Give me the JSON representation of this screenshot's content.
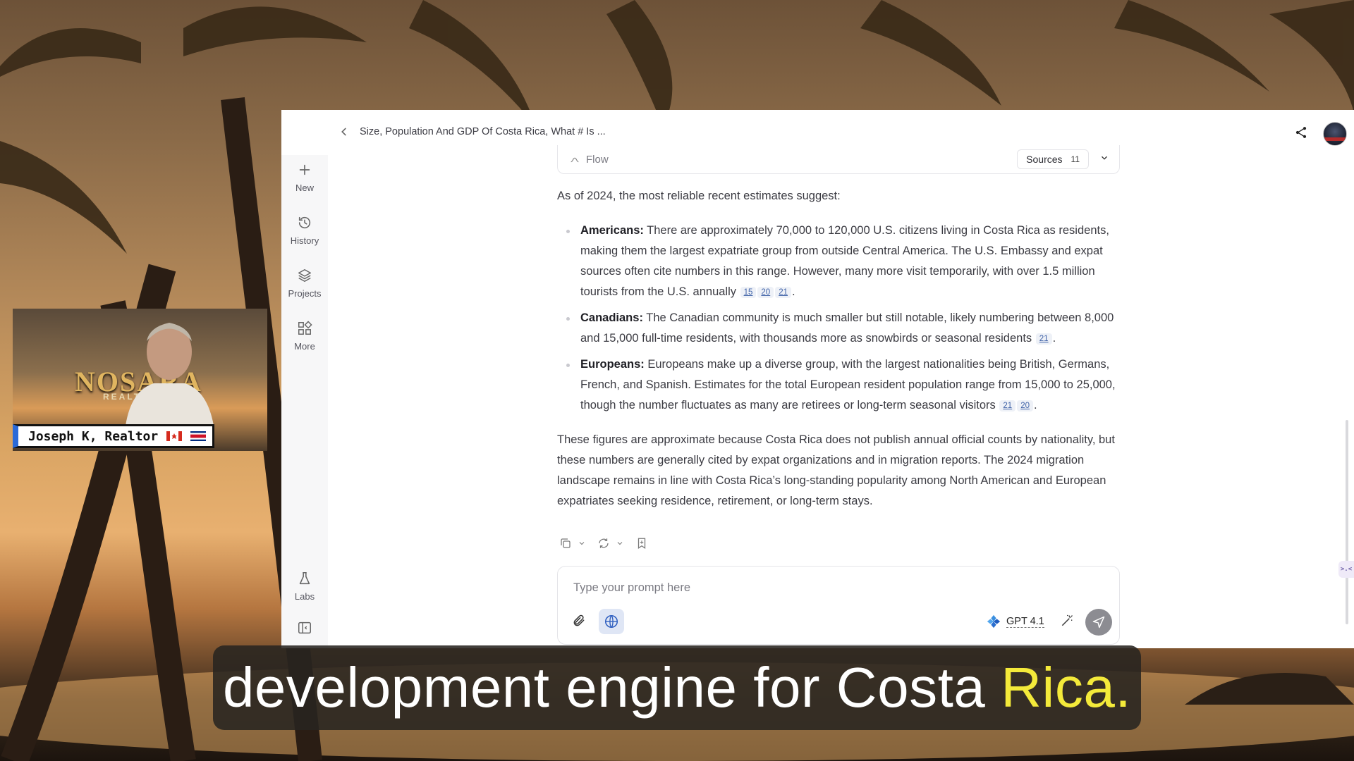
{
  "app": {
    "logo_text": ">.<",
    "conversation_title": "Size, Population And GDP Of Costa Rica, What # Is ...",
    "rail": {
      "new": "New",
      "history": "History",
      "projects": "Projects",
      "more": "More",
      "labs": "Labs"
    },
    "flow_label": "Flow",
    "sources_label": "Sources",
    "sources_count": "11",
    "intro": "As of 2024, the most reliable recent estimates suggest:",
    "bullets": [
      {
        "heading": "Americans:",
        "text": "There are approximately 70,000 to 120,000 U.S. citizens living in Costa Rica as residents, making them the largest expatriate group from outside Central America. The U.S. Embassy and expat sources often cite numbers in this range. However, many more visit temporarily, with over 1.5 million tourists from the U.S. annually",
        "cites": [
          "15",
          "20",
          "21"
        ]
      },
      {
        "heading": "Canadians:",
        "text": "The Canadian community is much smaller but still notable, likely numbering between 8,000 and 15,000 full-time residents, with thousands more as snowbirds or seasonal residents",
        "cites": [
          "21"
        ]
      },
      {
        "heading": "Europeans:",
        "text": "Europeans make up a diverse group, with the largest nationalities being British, Germans, French, and Spanish. Estimates for the total European resident population range from 15,000 to 25,000, though the number fluctuates as many are retirees or long-term seasonal visitors",
        "cites": [
          "21",
          "20"
        ]
      }
    ],
    "closing": "These figures are approximate because Costa Rica does not publish annual official counts by nationality, but these numbers are generally cited by expat organizations and in migration reports. The 2024 migration landscape remains in line with Costa Rica’s long-standing popularity among North American and European expatriates seeking residence, retirement, or long-term stays.",
    "prompt_placeholder": "Type your prompt here",
    "model_label": "GPT 4.1",
    "colors": {
      "accent": "#4063a8",
      "send": "#8c8c92",
      "globe_bg": "#dfe6f5"
    }
  },
  "overlay": {
    "presenter_name": "Joseph K, Realtor",
    "brand_text": "NOSARA",
    "brand_sub": "REALTY GROUP"
  },
  "caption": {
    "main": "development engine for Costa",
    "highlight": "Rica."
  }
}
